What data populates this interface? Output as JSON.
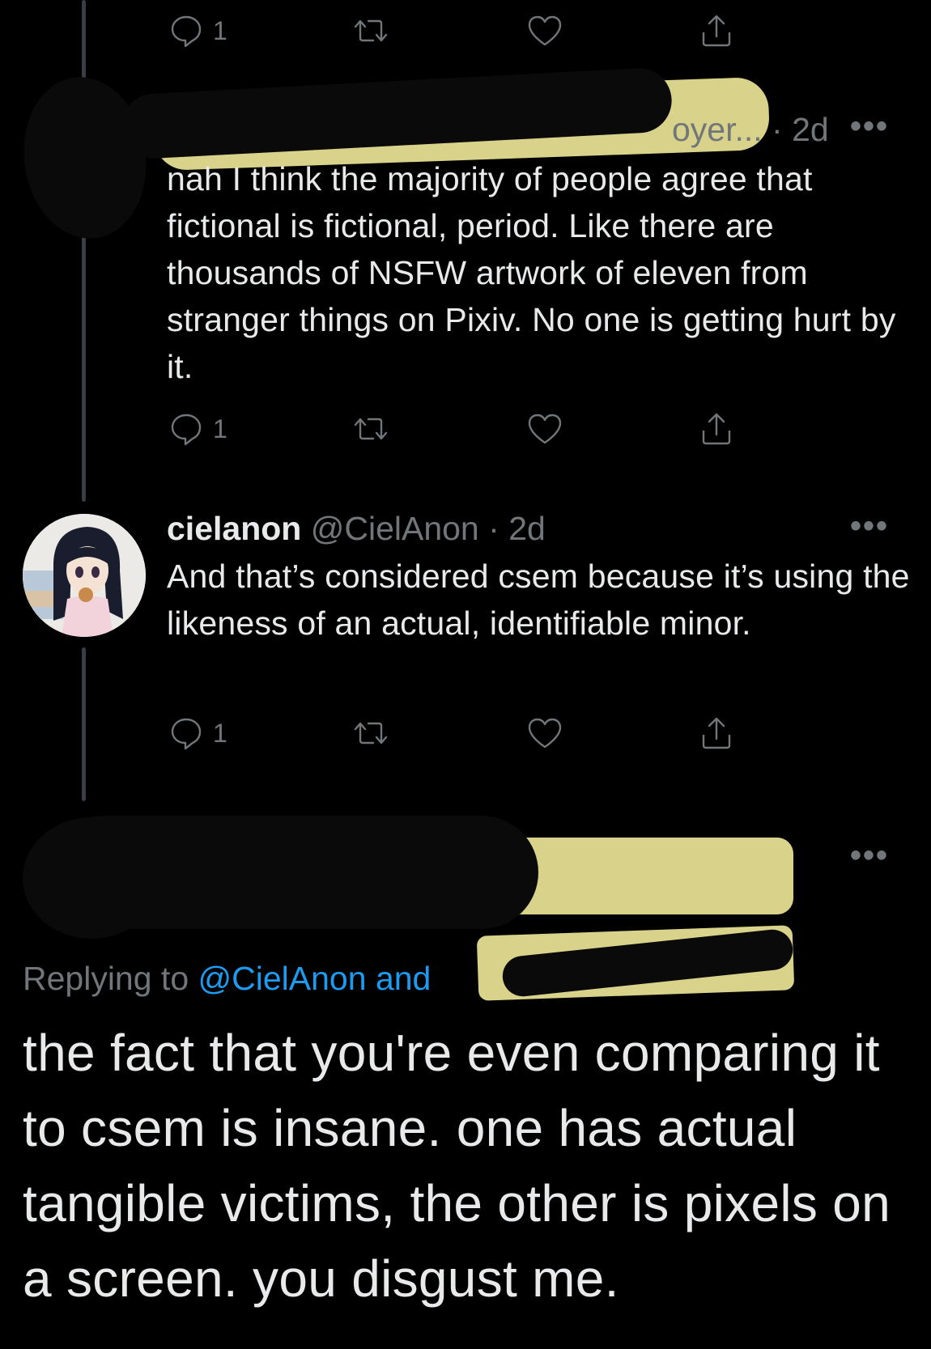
{
  "top_actions": {
    "reply_count": "1"
  },
  "tweet1": {
    "header_visible": "oyer... · 2d",
    "text": "nah I think the majority of people agree that fictional is fictional, period. Like there are thousands of NSFW artwork of eleven from stranger things on Pixiv. No one is getting hurt by it.",
    "reply_count": "1"
  },
  "tweet2": {
    "display_name": "cielanon",
    "handle": "@CielAnon",
    "time": "· 2d",
    "text": "And that’s considered csem because it’s using the likeness of an actual, identifiable minor.",
    "reply_count": "1"
  },
  "main_tweet": {
    "replying_prefix": "Replying to",
    "replying_mention": "@CielAnon",
    "replying_suffix": "and",
    "text": "the fact that you're even comparing it to csem is insane. one has actual tangible victims, the other is pixels on a screen. you disgust me."
  },
  "more_glyph": "•••",
  "icons": [
    "reply-icon",
    "retweet-icon",
    "like-icon",
    "share-icon",
    "more-icon"
  ],
  "colors": {
    "background": "#000000",
    "text": "#e7e9ea",
    "muted": "#71767b",
    "link": "#1d9bf0",
    "redaction_yellow": "#d9d28a"
  }
}
